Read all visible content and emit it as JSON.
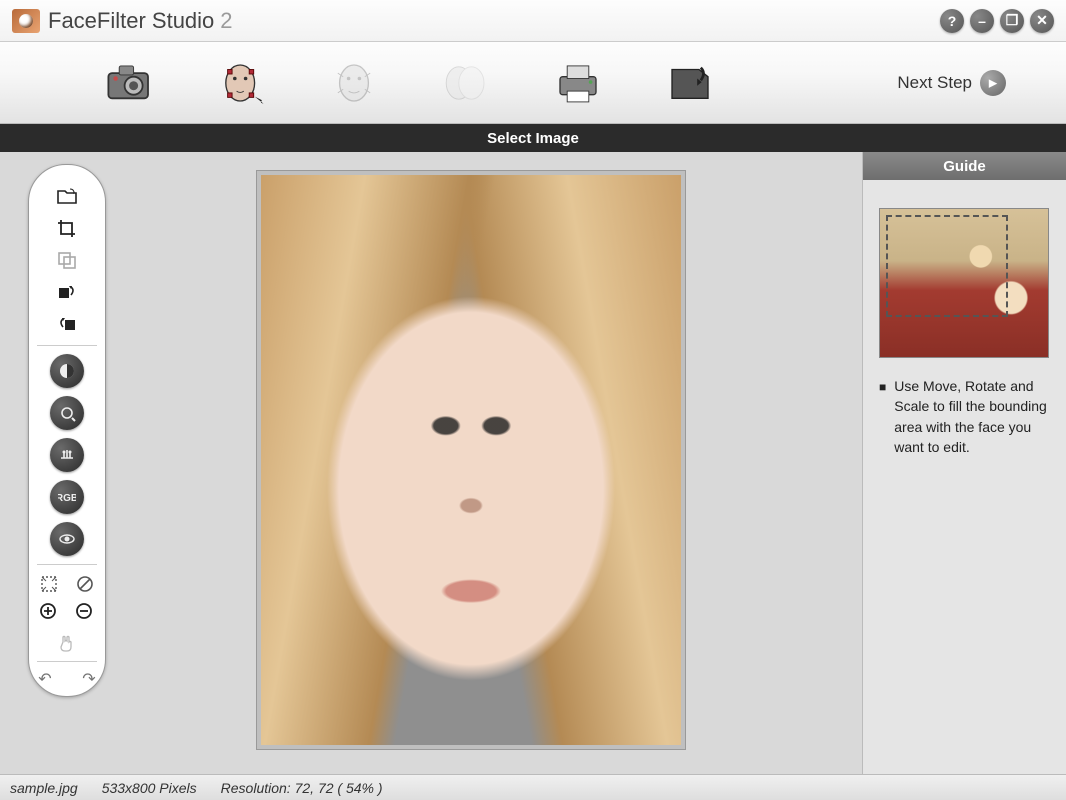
{
  "app": {
    "name": "FaceFilter Studio",
    "version": "2"
  },
  "window": {
    "help": "?",
    "min": "–",
    "max": "❐",
    "close": "✕"
  },
  "toolbar": {
    "steps": [
      {
        "id": "camera",
        "label": "Select Image"
      },
      {
        "id": "fit-points",
        "label": "Fit Points"
      },
      {
        "id": "expression",
        "label": "Expression"
      },
      {
        "id": "skin",
        "label": "Skin"
      },
      {
        "id": "print",
        "label": "Print"
      },
      {
        "id": "save",
        "label": "Save"
      }
    ],
    "next_label": "Next Step"
  },
  "section": {
    "title": "Select Image"
  },
  "left_tools": {
    "open": "open-icon",
    "crop": "crop-icon",
    "copy": "copy-icon",
    "rotate_cw": "rotate-cw-icon",
    "rotate_ccw": "rotate-ccw-icon",
    "dark": [
      "contrast",
      "sharpen",
      "balance",
      "color",
      "eye"
    ],
    "fit": "fit-icon",
    "reset": "reset-icon",
    "zoom_in": "+",
    "zoom_out": "−",
    "pan": "hand-icon",
    "undo": "↶",
    "redo": "↷"
  },
  "guide": {
    "title": "Guide",
    "text": "Use Move, Rotate and Scale to fill the bounding area with the face you want to edit."
  },
  "status": {
    "filename": "sample.jpg",
    "dimensions": "533x800 Pixels",
    "resolution_label": "Resolution:",
    "resolution": "72, 72",
    "zoom": "( 54% )"
  }
}
